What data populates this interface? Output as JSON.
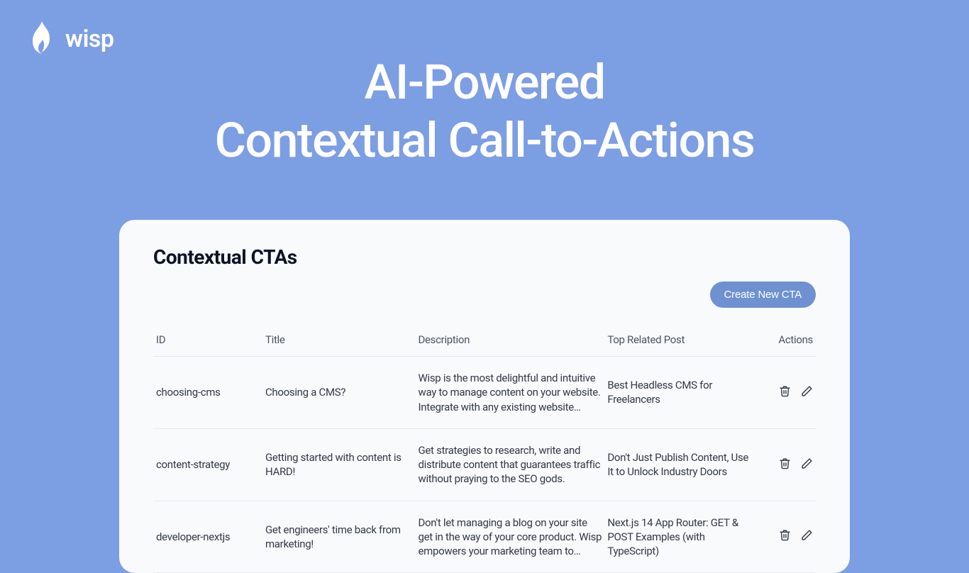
{
  "brand": {
    "name": "wisp"
  },
  "hero": {
    "line1": "AI-Powered",
    "line2": "Contextual Call-to-Actions"
  },
  "card": {
    "title": "Contextual CTAs",
    "create_label": "Create New CTA",
    "columns": {
      "id": "ID",
      "title": "Title",
      "description": "Description",
      "related": "Top Related Post",
      "actions": "Actions"
    },
    "rows": [
      {
        "id": "choosing-cms",
        "title": "Choosing a CMS?",
        "description": "Wisp is the most delightful and intuitive way to manage content on your website. Integrate with any existing website withi…",
        "related": "Best Headless CMS for Freelancers"
      },
      {
        "id": "content-strategy",
        "title": "Getting started with content is HARD!",
        "description": "Get strategies to research, write and distribute content that guarantees traffic without praying to the SEO gods.",
        "related": "Don't Just Publish Content, Use It to Unlock Industry Doors"
      },
      {
        "id": "developer-nextjs",
        "title": "Get engineers' time back from marketing!",
        "description": "Don't let managing a blog on your site get in the way of your core product. Wisp empowers your marketing team to creat…",
        "related": "Next.js 14 App Router: GET & POST Examples (with TypeScript)"
      }
    ]
  }
}
